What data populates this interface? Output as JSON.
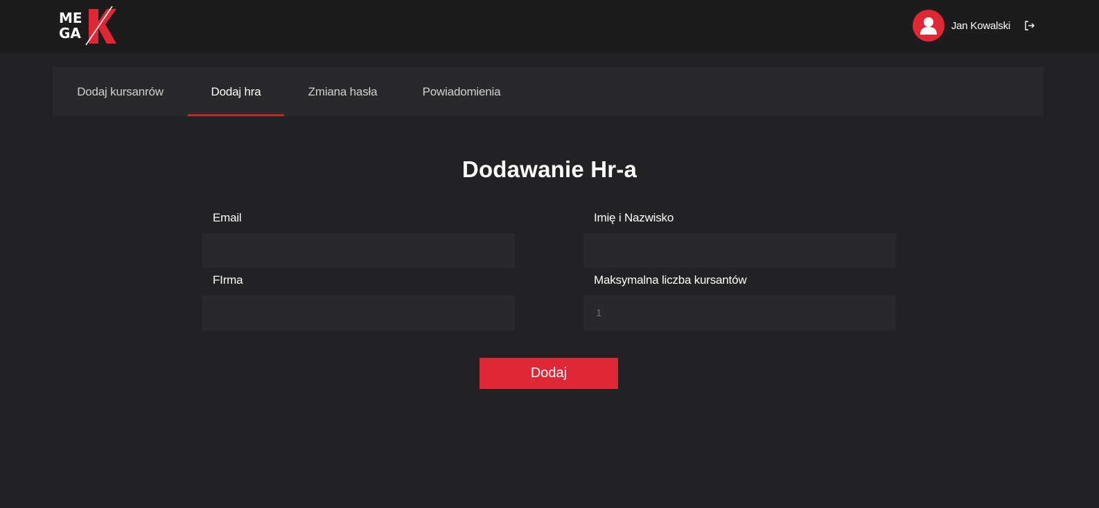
{
  "header": {
    "logo": {
      "text_line1": "ME",
      "text_line2": "GA",
      "mark": "K",
      "accent_color": "#e02735"
    },
    "user": {
      "avatar_icon": "user-icon",
      "name": "Jan Kowalski",
      "logout_icon": "logout-icon"
    }
  },
  "tabs": [
    {
      "label": "Dodaj kursanrów",
      "active": false
    },
    {
      "label": "Dodaj hra",
      "active": true
    },
    {
      "label": "Zmiana hasła",
      "active": false
    },
    {
      "label": "Powiadomienia",
      "active": false
    }
  ],
  "form": {
    "title": "Dodawanie Hr-a",
    "email": {
      "label": "Email",
      "value": "",
      "placeholder": ""
    },
    "name": {
      "label": "Imię i Nazwisko",
      "value": "",
      "placeholder": ""
    },
    "company": {
      "label": "FIrma",
      "value": "",
      "placeholder": ""
    },
    "max_students": {
      "label": "Maksymalna liczba kursantów",
      "value": "",
      "placeholder": "1"
    },
    "submit_label": "Dodaj"
  },
  "colors": {
    "accent": "#e02735",
    "tab_underline": "#c4262d",
    "background": "#222224",
    "panel": "#29292b"
  }
}
